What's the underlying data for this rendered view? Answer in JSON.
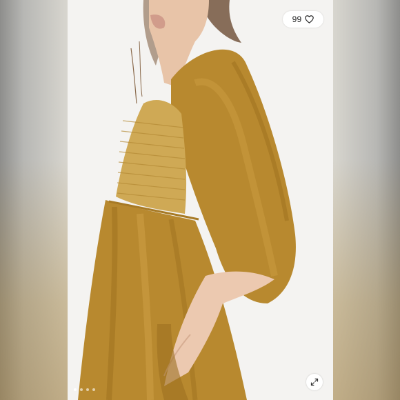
{
  "listing": {
    "likes": {
      "count": "99",
      "icon": "heart-icon"
    },
    "expand": {
      "icon": "expand-arrows-icon"
    },
    "carousel": {
      "slide_count": 4,
      "active_index": 0
    },
    "photo": {
      "description_colors": {
        "velvet": "#b8892f",
        "velvet_shadow": "#8f6518",
        "backdrop": "#f4f3f1",
        "skin": "#e9c7ae",
        "hair": "#6b4b33"
      }
    }
  }
}
